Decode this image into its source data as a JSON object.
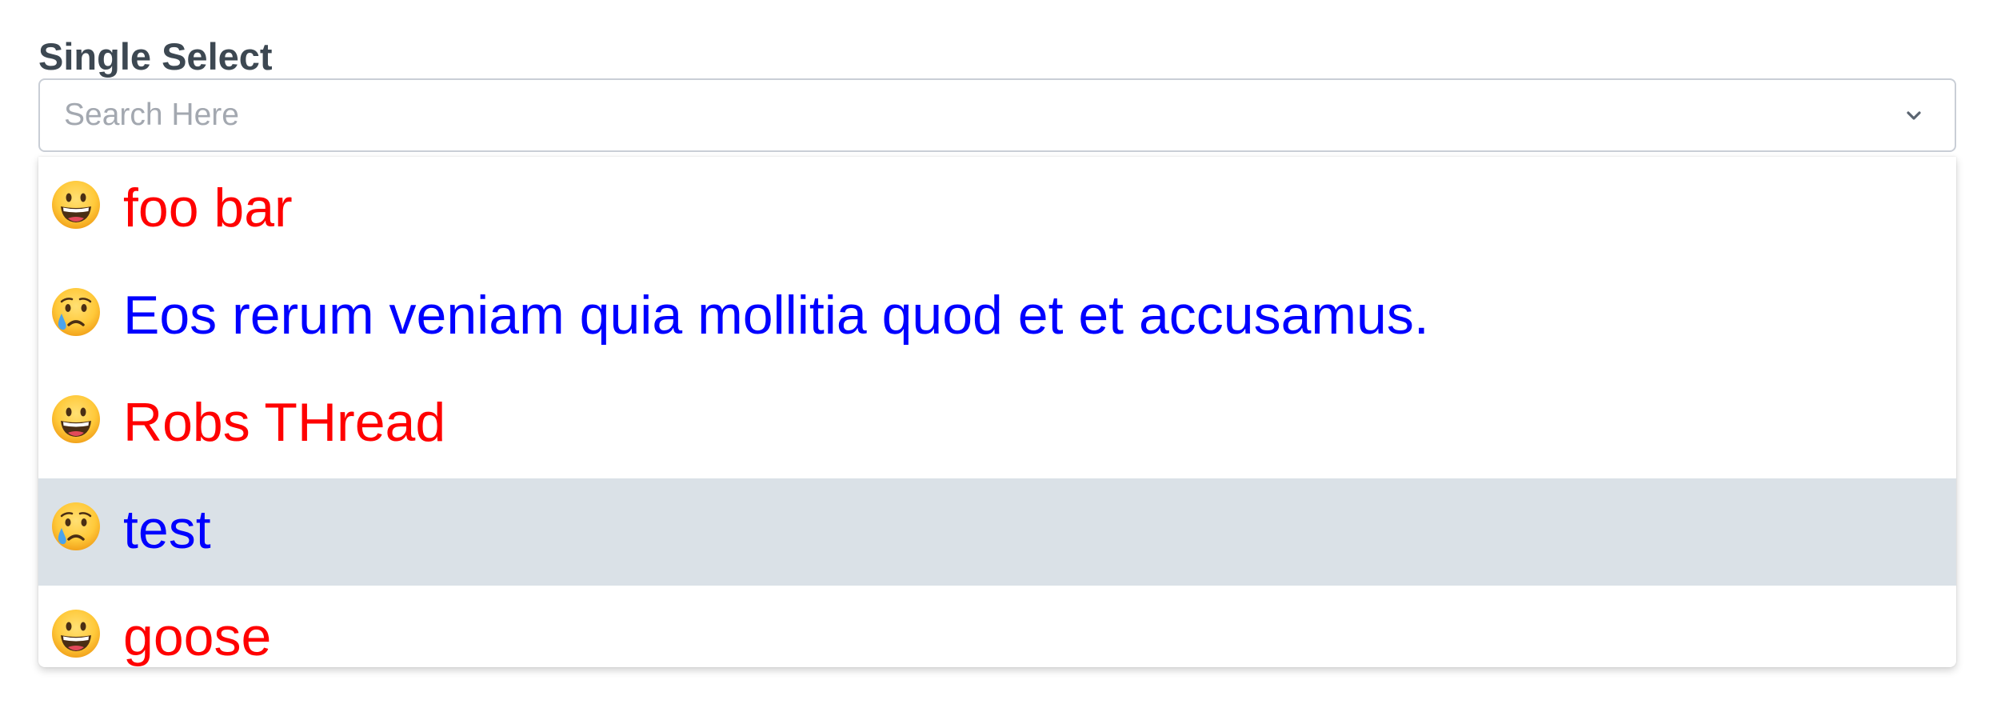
{
  "field": {
    "label": "Single Select",
    "placeholder": "Search Here",
    "value": ""
  },
  "toggle_icon": "chevron-down-icon",
  "options": [
    {
      "emoji": "grinning-face-icon",
      "label": "foo bar",
      "color": "#ff0000",
      "highlighted": false
    },
    {
      "emoji": "crying-face-icon",
      "label": "Eos rerum veniam quia mollitia quod et et accusamus.",
      "color": "#0000ff",
      "highlighted": false
    },
    {
      "emoji": "grinning-face-icon",
      "label": "Robs THread",
      "color": "#ff0000",
      "highlighted": false
    },
    {
      "emoji": "crying-face-icon",
      "label": "test",
      "color": "#0000ff",
      "highlighted": true
    },
    {
      "emoji": "grinning-face-icon",
      "label": "goose",
      "color": "#ff0000",
      "highlighted": false
    }
  ],
  "colors": {
    "label_text": "#3d4852",
    "input_border": "#c9ced6",
    "placeholder": "#a3a8b0",
    "highlight_bg": "#dae1e7"
  }
}
